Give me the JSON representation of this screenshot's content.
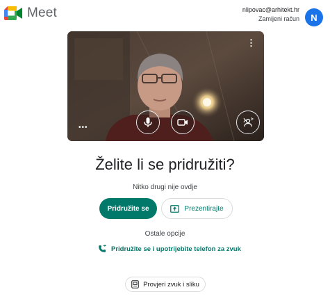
{
  "app": {
    "name": "Meet"
  },
  "account": {
    "email": "nlipovac@arhitekt.hr",
    "switch_label": "Zamijeni račun",
    "avatar_initial": "N"
  },
  "preview": {
    "menu_icon": "more-vert-icon",
    "effects_menu_icon": "more-horiz-icon",
    "controls": [
      {
        "name": "microphone",
        "icon": "mic-icon",
        "state": "on"
      },
      {
        "name": "camera",
        "icon": "videocam-icon",
        "state": "on"
      },
      {
        "name": "visual-effects",
        "icon": "visual-effects-icon"
      }
    ]
  },
  "main": {
    "title": "Želite li se pridružiti?",
    "status": "Nitko drugi nije ovdje",
    "join_label": "Pridružite se",
    "present_label": "Prezentirajte",
    "other_options_label": "Ostale opcije",
    "phone_join_label": "Pridružite se i upotrijebite telefon za zvuk",
    "check_av_label": "Provjeri zvuk i sliku"
  },
  "colors": {
    "accent": "#00796b",
    "avatar": "#1a73e8",
    "text": "#202124",
    "secondary_text": "#3c4043"
  }
}
